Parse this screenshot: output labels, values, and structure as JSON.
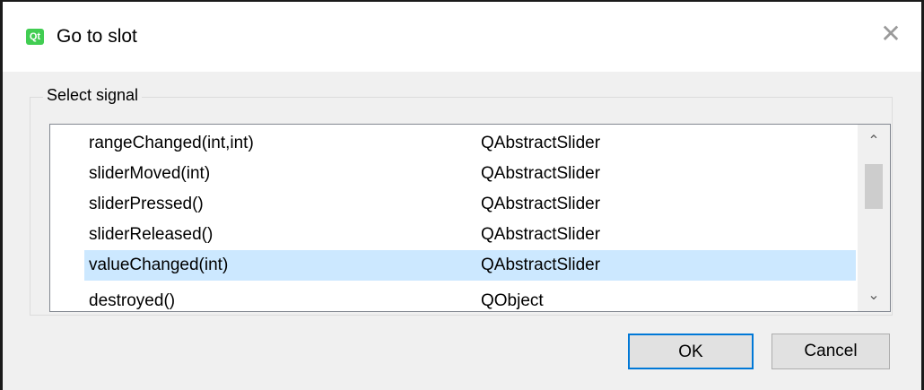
{
  "window": {
    "title": "Go to slot",
    "icon_text": "Qt"
  },
  "group": {
    "title": "Select signal"
  },
  "signals": [
    {
      "signal": "rangeChanged(int,int)",
      "class": "QAbstractSlider",
      "selected": false
    },
    {
      "signal": "sliderMoved(int)",
      "class": "QAbstractSlider",
      "selected": false
    },
    {
      "signal": "sliderPressed()",
      "class": "QAbstractSlider",
      "selected": false
    },
    {
      "signal": "sliderReleased()",
      "class": "QAbstractSlider",
      "selected": false
    },
    {
      "signal": "valueChanged(int)",
      "class": "QAbstractSlider",
      "selected": true
    },
    {
      "signal": "destroyed()",
      "class": "QObject",
      "selected": false
    }
  ],
  "buttons": {
    "ok": "OK",
    "cancel": "Cancel"
  },
  "icons": {
    "close": "close-icon",
    "scroll_up": "chevron-up-icon",
    "scroll_down": "chevron-down-icon"
  },
  "colors": {
    "selection": "#cce8ff",
    "default_button_border": "#0078d7"
  }
}
